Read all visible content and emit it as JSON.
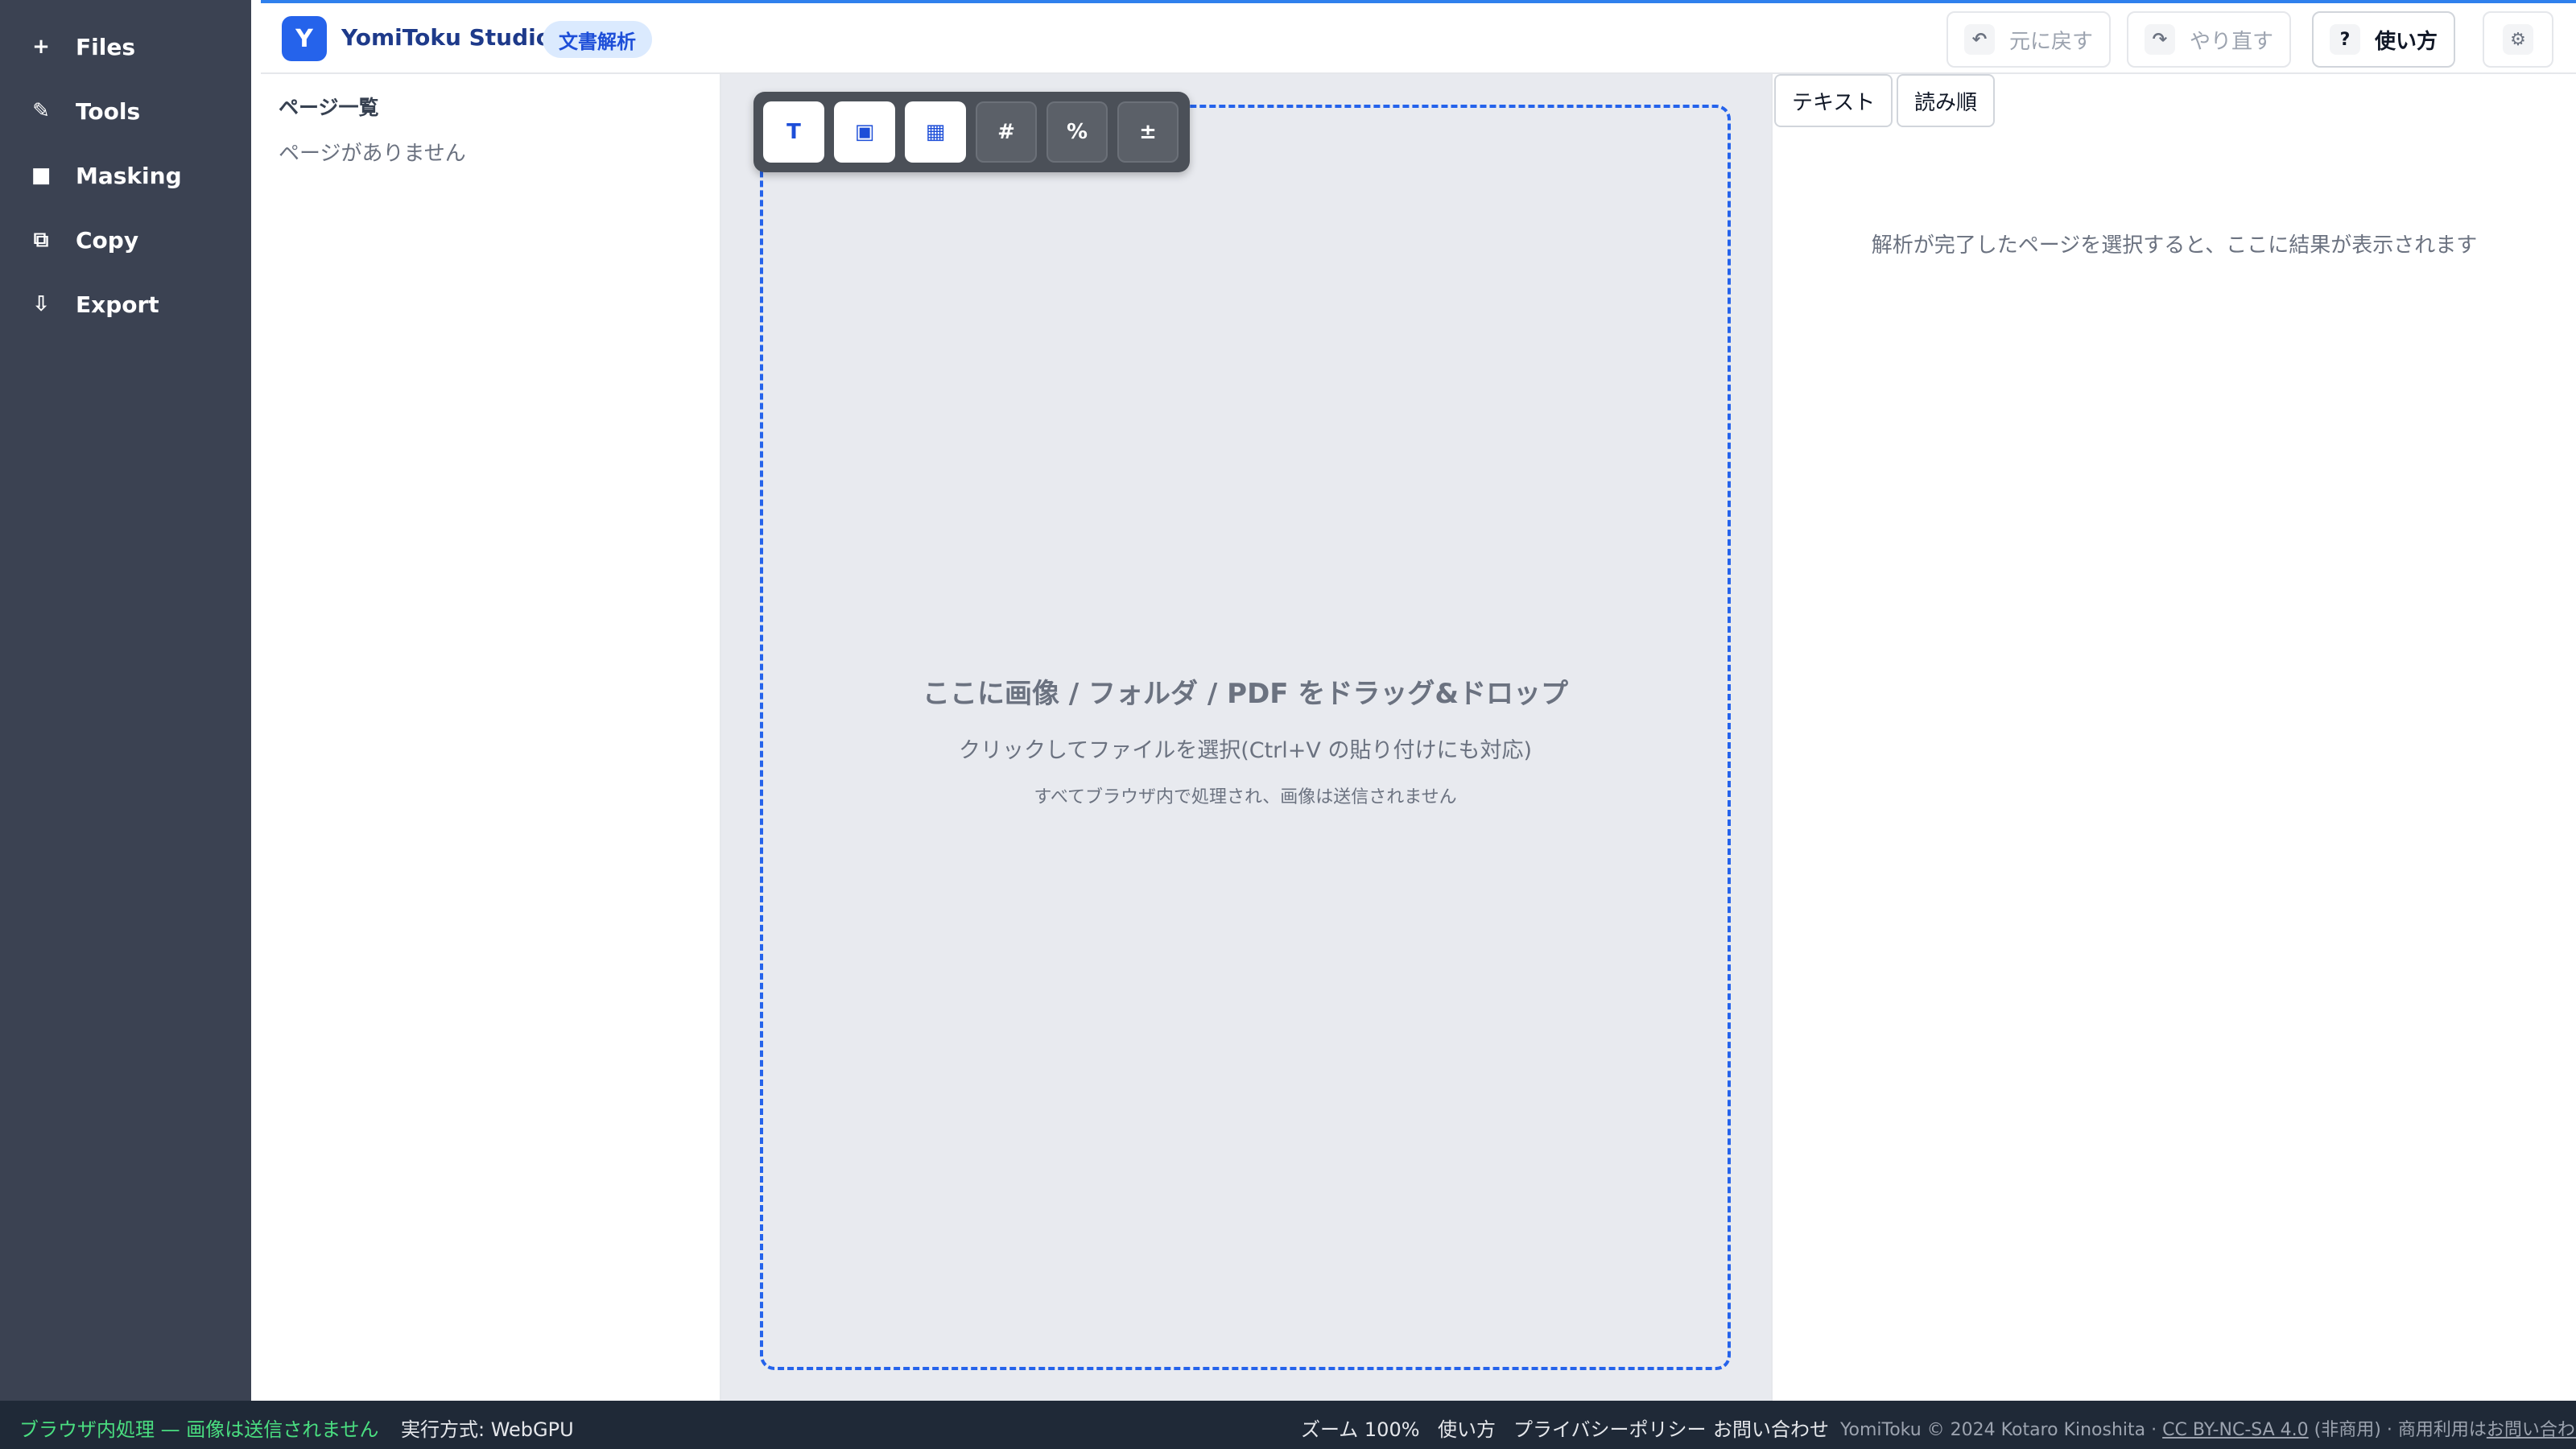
{
  "sidebar": {
    "items": [
      {
        "icon": "+",
        "label": "Files"
      },
      {
        "icon": "✎",
        "label": "Tools"
      },
      {
        "icon": "■",
        "label": "Masking"
      },
      {
        "icon": "⧉",
        "label": "Copy"
      },
      {
        "icon": "⇩",
        "label": "Export"
      }
    ]
  },
  "header": {
    "logo_letter": "Y",
    "app_title": "YomiToku Studio",
    "mode_badge": "文書解析",
    "undo_icon": "↶",
    "undo_label": "元に戻す",
    "redo_icon": "↷",
    "redo_label": "やり直す",
    "help_icon": "?",
    "help_label": "使い方",
    "settings_icon": "⚙"
  },
  "pagelist": {
    "title": "ページ一覧",
    "empty_text": "ページがありません"
  },
  "toolbar": {
    "buttons": [
      {
        "glyph": "T",
        "name": "text",
        "active": true
      },
      {
        "glyph": "▣",
        "name": "figure",
        "active": true
      },
      {
        "glyph": "▦",
        "name": "table",
        "active": true
      },
      {
        "glyph": "#",
        "name": "number",
        "active": false
      },
      {
        "glyph": "%",
        "name": "percent",
        "active": false
      },
      {
        "glyph": "±",
        "name": "plus-minus",
        "active": false
      }
    ]
  },
  "dropzone": {
    "main": "ここに画像 / フォルダ / PDF をドラッグ&ドロップ",
    "sub": "クリックしてファイルを選択(Ctrl+V の貼り付けにも対応)",
    "note": "すべてブラウザ内で処理され、画像は送信されません"
  },
  "results": {
    "tabs": [
      "テキスト",
      "読み順"
    ],
    "empty_text": "解析が完了したページを選択すると、ここに結果が表示されます"
  },
  "statusbar": {
    "privacy": "ブラウザ内処理 — 画像は送信されません",
    "runtime": "実行方式: WebGPU",
    "zoom": "ズーム 100%",
    "help_link": "使い方",
    "privacy_policy": "プライバシーポリシー",
    "contact": "お問い合わせ",
    "copyright": "YomiToku © 2024 Kotaro Kinoshita ·",
    "license": "CC BY-NC-SA 4.0",
    "noncommercial": "(非商用) · 商用利用は",
    "commercial_contact": "お問い合わせ"
  },
  "colors": {
    "accent": "#2563eb",
    "sidebar_bg": "#3b4252",
    "statusbar_bg": "#1f2937",
    "status_green": "#4ade80"
  }
}
